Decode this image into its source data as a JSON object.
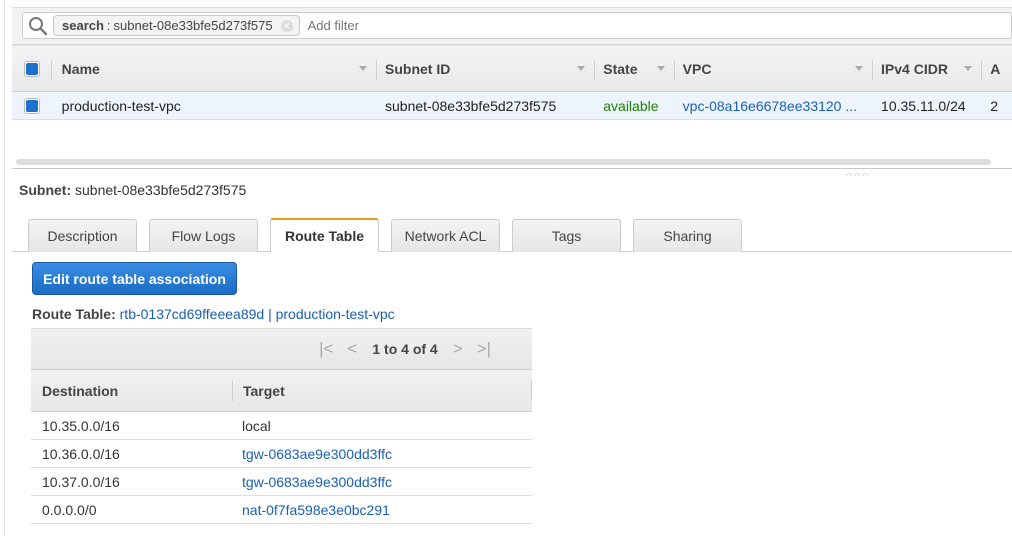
{
  "filter": {
    "token_key": "search",
    "token_sep": ":",
    "token_value": "subnet-08e33bfe5d273f575",
    "placeholder": "Add filter"
  },
  "grid": {
    "columns": [
      "Name",
      "Subnet ID",
      "State",
      "VPC",
      "IPv4 CIDR",
      "A"
    ],
    "rows": [
      {
        "name": "production-test-vpc",
        "subnet_id": "subnet-08e33bfe5d273f575",
        "state": "available",
        "vpc": "vpc-08a16e6678ee33120 ...",
        "ipv4_cidr": "10.35.11.0/24",
        "more": "2"
      }
    ]
  },
  "detail": {
    "subnet_label": "Subnet:",
    "subnet_value": "subnet-08e33bfe5d273f575",
    "tabs": [
      "Description",
      "Flow Logs",
      "Route Table",
      "Network ACL",
      "Tags",
      "Sharing"
    ],
    "active_tab": "Route Table",
    "edit_button": "Edit route table association",
    "route_table_label": "Route Table:",
    "route_table_link": "rtb-0137cd69ffeeea89d | production-test-vpc",
    "pager_text": "1 to 4 of 4",
    "route_columns": [
      "Destination",
      "Target"
    ],
    "routes": [
      {
        "destination": "10.35.0.0/16",
        "target": "local"
      },
      {
        "destination": "10.36.0.0/16",
        "target": "tgw-0683ae9e300dd3ffc"
      },
      {
        "destination": "10.37.0.0/16",
        "target": "tgw-0683ae9e300dd3ffc"
      },
      {
        "destination": "0.0.0.0/0",
        "target": "nat-0f7fa598e3e0bc291"
      }
    ]
  },
  "colors": {
    "accent_blue": "#1f6fce",
    "link": "#1a5fb4",
    "available": "#1d8102",
    "active_tab_border": "#ec9a1d"
  }
}
